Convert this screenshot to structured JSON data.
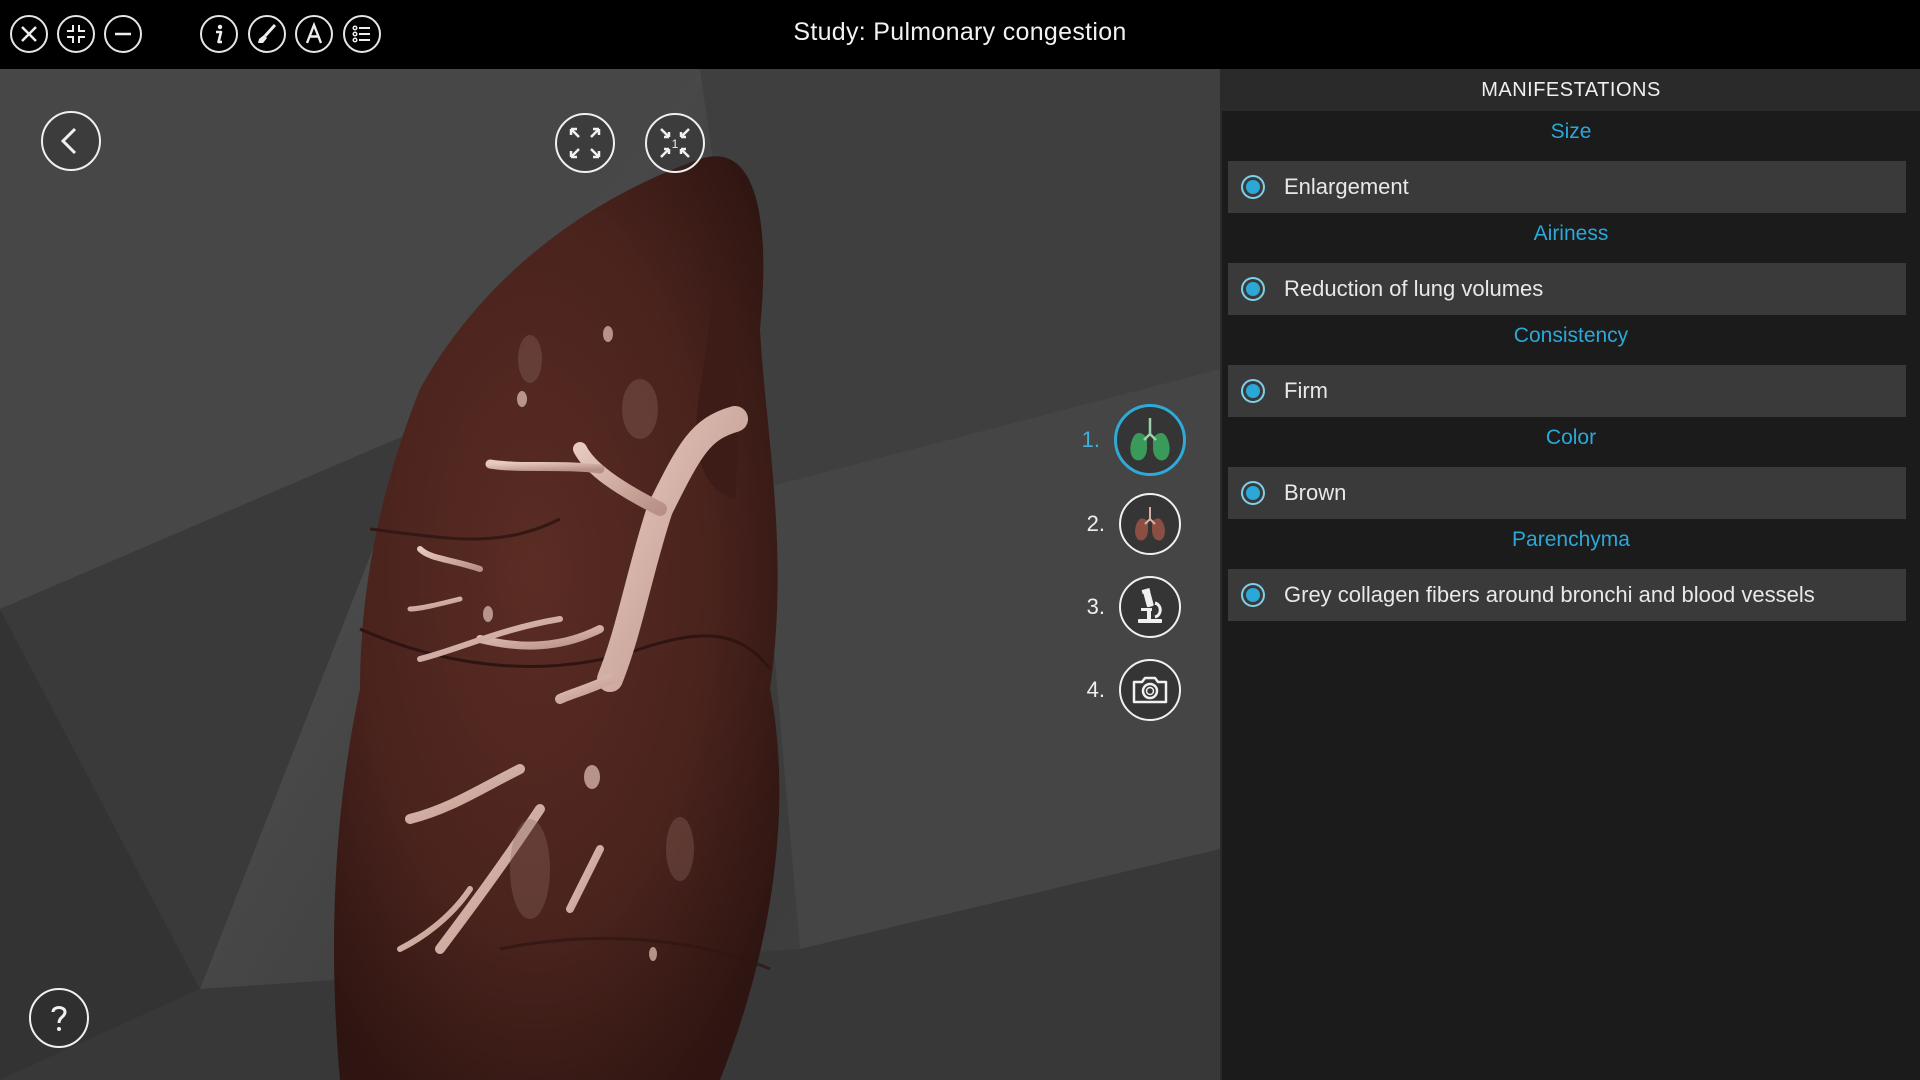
{
  "topbar": {
    "title": "Study: Pulmonary congestion",
    "buttons": [
      {
        "name": "close-icon"
      },
      {
        "name": "collapse-icon"
      },
      {
        "name": "minimize-icon"
      },
      {
        "name": "info-icon"
      },
      {
        "name": "brush-icon"
      },
      {
        "name": "annotation-a-icon"
      },
      {
        "name": "list-icon"
      }
    ]
  },
  "viewport": {
    "back_icon": "chevron-left-icon",
    "expand_icon": "expand-icon",
    "collapse_icon": "collapse-1-icon",
    "collapse_badge": "1",
    "help_icon": "question-icon",
    "steps": [
      {
        "number": "1.",
        "icon": "lungs-green-icon",
        "active": true
      },
      {
        "number": "2.",
        "icon": "lungs-brown-icon",
        "active": false
      },
      {
        "number": "3.",
        "icon": "microscope-icon",
        "active": false
      },
      {
        "number": "4.",
        "icon": "camera-icon",
        "active": false
      }
    ]
  },
  "panel": {
    "header": "MANIFESTATIONS",
    "categories": [
      {
        "title": "Size",
        "item": "Enlargement"
      },
      {
        "title": "Airiness",
        "item": "Reduction of lung volumes"
      },
      {
        "title": "Consistency",
        "item": "Firm"
      },
      {
        "title": "Color",
        "item": "Brown"
      },
      {
        "title": "Parenchyma",
        "item": "Grey collagen fibers around bronchi and blood vessels"
      }
    ]
  },
  "colors": {
    "accent": "#2aa8d8",
    "topbar_bg": "#000000",
    "panel_bg": "#1b1b1b",
    "item_bg": "#3a3a3a",
    "organ": "#4e2620"
  }
}
